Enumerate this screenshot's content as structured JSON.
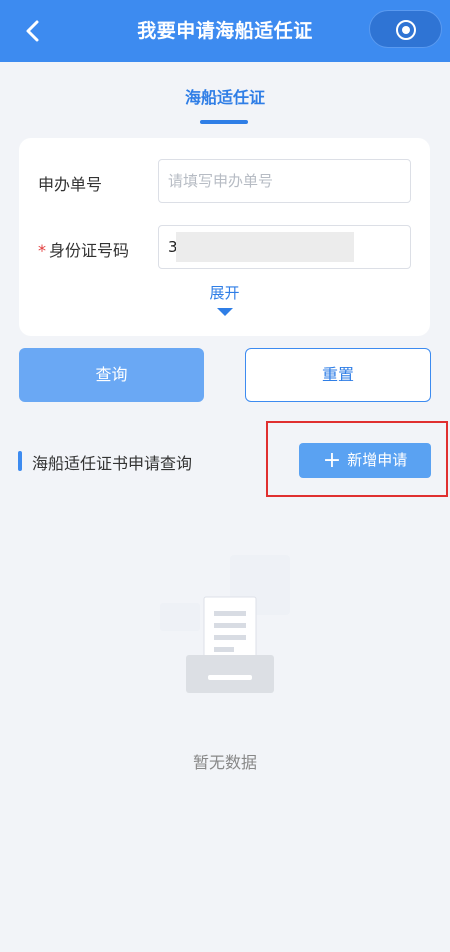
{
  "header": {
    "title": "我要申请海船适任证"
  },
  "tabs": [
    {
      "label": "海船适任证",
      "active": true
    }
  ],
  "form": {
    "application_no": {
      "label": "申办单号",
      "placeholder": "请填写申办单号",
      "value": ""
    },
    "id_number": {
      "label": "身份证号码",
      "required_mark": "*",
      "value": "3"
    },
    "expand_label": "展开"
  },
  "actions": {
    "query_label": "查询",
    "reset_label": "重置"
  },
  "section": {
    "title": "海船适任证书申请查询",
    "new_button_label": "新增申请",
    "new_button_icon": "+"
  },
  "empty_state": {
    "text": "暂无数据"
  },
  "colors": {
    "primary": "#3d8bf0",
    "required": "#e23b3b",
    "highlight": "#e03030"
  }
}
